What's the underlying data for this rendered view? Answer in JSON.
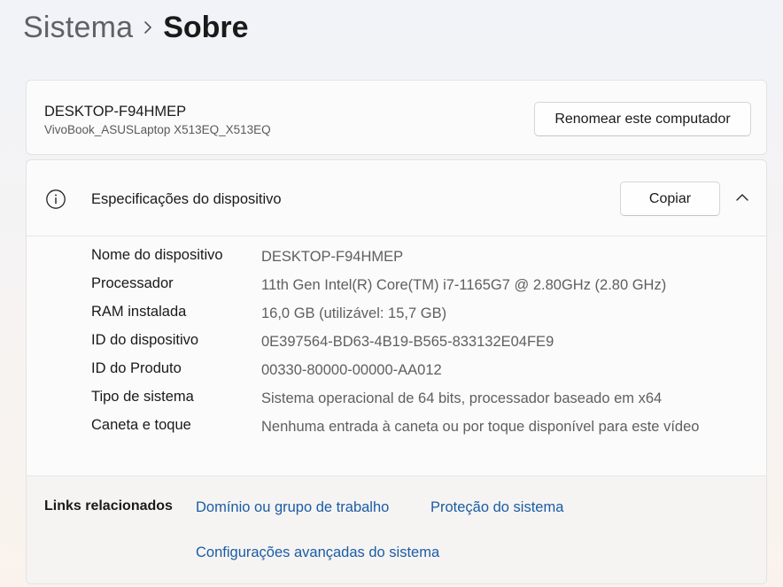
{
  "breadcrumb": {
    "parent": "Sistema",
    "current": "Sobre"
  },
  "device": {
    "name": "DESKTOP-F94HMEP",
    "model": "VivoBook_ASUSLaptop X513EQ_X513EQ",
    "rename_label": "Renomear este computador"
  },
  "specs": {
    "title": "Especificações do dispositivo",
    "copy_label": "Copiar",
    "rows": [
      {
        "label": "Nome do dispositivo",
        "value": "DESKTOP-F94HMEP"
      },
      {
        "label": "Processador",
        "value": "11th Gen Intel(R) Core(TM) i7-1165G7 @ 2.80GHz (2.80 GHz)"
      },
      {
        "label": "RAM instalada",
        "value": "16,0 GB (utilizável: 15,7 GB)"
      },
      {
        "label": "ID do dispositivo",
        "value": "0E397564-BD63-4B19-B565-833132E04FE9"
      },
      {
        "label": "ID do Produto",
        "value": "00330-80000-00000-AA012"
      },
      {
        "label": "Tipo de sistema",
        "value": "Sistema operacional de 64 bits, processador baseado em x64"
      },
      {
        "label": "Caneta e toque",
        "value": "Nenhuma entrada à caneta ou por toque disponível para este vídeo"
      }
    ]
  },
  "related": {
    "title": "Links relacionados",
    "links": [
      "Domínio ou grupo de trabalho",
      "Proteção do sistema",
      "Configurações avançadas do sistema"
    ]
  },
  "colors": {
    "link": "#1a5ca6",
    "accent_text": "#1a1a1a",
    "muted_text": "#5f5f5f"
  }
}
